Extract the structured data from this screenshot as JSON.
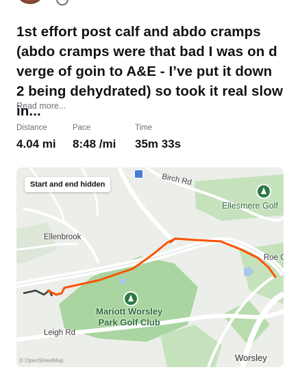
{
  "post": {
    "title": "1st effort post calf and abdo cramps (abdo cramps were that bad I was on d verge of goin to A&E - I’ve put it down 2 being dehydrated) so took it real slow in...",
    "read_more": "Read more..."
  },
  "stats": [
    {
      "label": "Distance",
      "value": "4.04 mi"
    },
    {
      "label": "Pace",
      "value": "8:48 /mi"
    },
    {
      "label": "Time",
      "value": "35m 33s"
    }
  ],
  "map": {
    "badge": "Start and end hidden",
    "places": {
      "birch_rd": "Birch Rd",
      "ellesmere_golf": "Ellesmere Golf",
      "ellenbrook": "Ellenbrook",
      "roe": "Roe C",
      "golf_club_line1": "Mariott Worsley",
      "golf_club_line2": "Park Golf Club",
      "leigh_rd": "Leigh Rd",
      "worsley": "Worsley"
    },
    "route_color": "#fc5200",
    "hidden_route_color": "#3a3a3a",
    "attribution": "© OpenStreetMap"
  },
  "colors": {
    "accent": "#fc5200",
    "park_green": "#a9d5a0",
    "road": "#ffffff"
  }
}
